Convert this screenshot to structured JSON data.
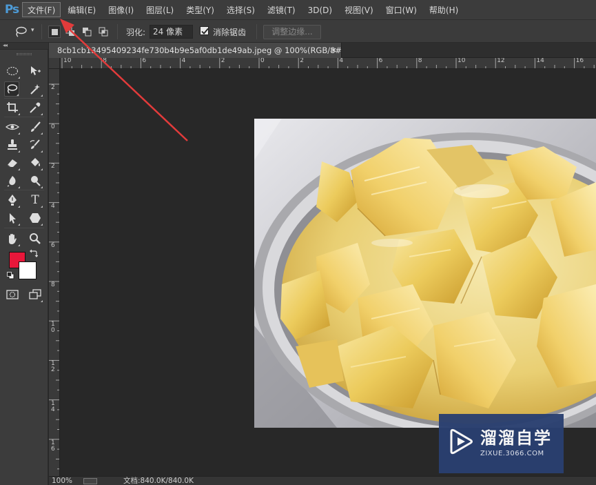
{
  "app": {
    "logo": "Ps",
    "accent_color": "#4d9bd7"
  },
  "menu": {
    "items": [
      {
        "label": "文件(F)",
        "active": true
      },
      {
        "label": "编辑(E)"
      },
      {
        "label": "图像(I)"
      },
      {
        "label": "图层(L)"
      },
      {
        "label": "类型(Y)"
      },
      {
        "label": "选择(S)"
      },
      {
        "label": "滤镜(T)"
      },
      {
        "label": "3D(D)"
      },
      {
        "label": "视图(V)"
      },
      {
        "label": "窗口(W)"
      },
      {
        "label": "帮助(H)"
      }
    ]
  },
  "options": {
    "tool_icon": "lasso-icon",
    "selection_modes": [
      "new-selection",
      "add-to-selection",
      "subtract-from-selection",
      "intersect-with-selection"
    ],
    "active_mode": "new-selection",
    "feather_label": "羽化:",
    "feather_value": "24 像素",
    "antialias_checked": true,
    "antialias_label": "消除锯齿",
    "refine_edge_label": "调整边缘..."
  },
  "tools": {
    "items": [
      "marquee-icon",
      "move-icon",
      "lasso-icon",
      "magic-wand-icon",
      "crop-icon",
      "eyedropper-icon",
      "spot-healing-icon",
      "brush-icon",
      "clone-stamp-icon",
      "history-brush-icon",
      "eraser-icon",
      "paint-bucket-icon",
      "blur-icon",
      "dodge-icon",
      "pen-icon",
      "type-icon",
      "path-selection-icon",
      "shape-icon",
      "hand-icon",
      "zoom-icon"
    ],
    "active_tool": "lasso-icon",
    "foreground_color": "#e8173a",
    "background_color": "#ffffff",
    "type_glyph": "T",
    "collapse_glyph": "◂◂"
  },
  "document": {
    "tab_title": "8cb1cb13495409234fe730b4b9e5af0db1de49ab.jpeg @ 100%(RGB/8#)",
    "tab_close": "×",
    "ruler_h_labels": [
      "10",
      "8",
      "6",
      "4",
      "2",
      "0",
      "2",
      "4",
      "6",
      "8",
      "10",
      "12",
      "14",
      "16"
    ],
    "ruler_v_labels": [
      "2",
      "0",
      "2",
      "4",
      "6",
      "8",
      "1",
      "1",
      "1",
      "1"
    ],
    "ruler_v_second": [
      "",
      "",
      "",
      "",
      "",
      "",
      "0",
      "2",
      "4",
      "6"
    ]
  },
  "watermark": {
    "title": "溜溜自学",
    "url": "ZIXUE.3066.COM",
    "color": "#2a3f70"
  },
  "status": {
    "zoom": "100%",
    "doc_info": "文档:840.0K/840.0K"
  },
  "annotation": {
    "arrow_color": "#e23b3b"
  }
}
